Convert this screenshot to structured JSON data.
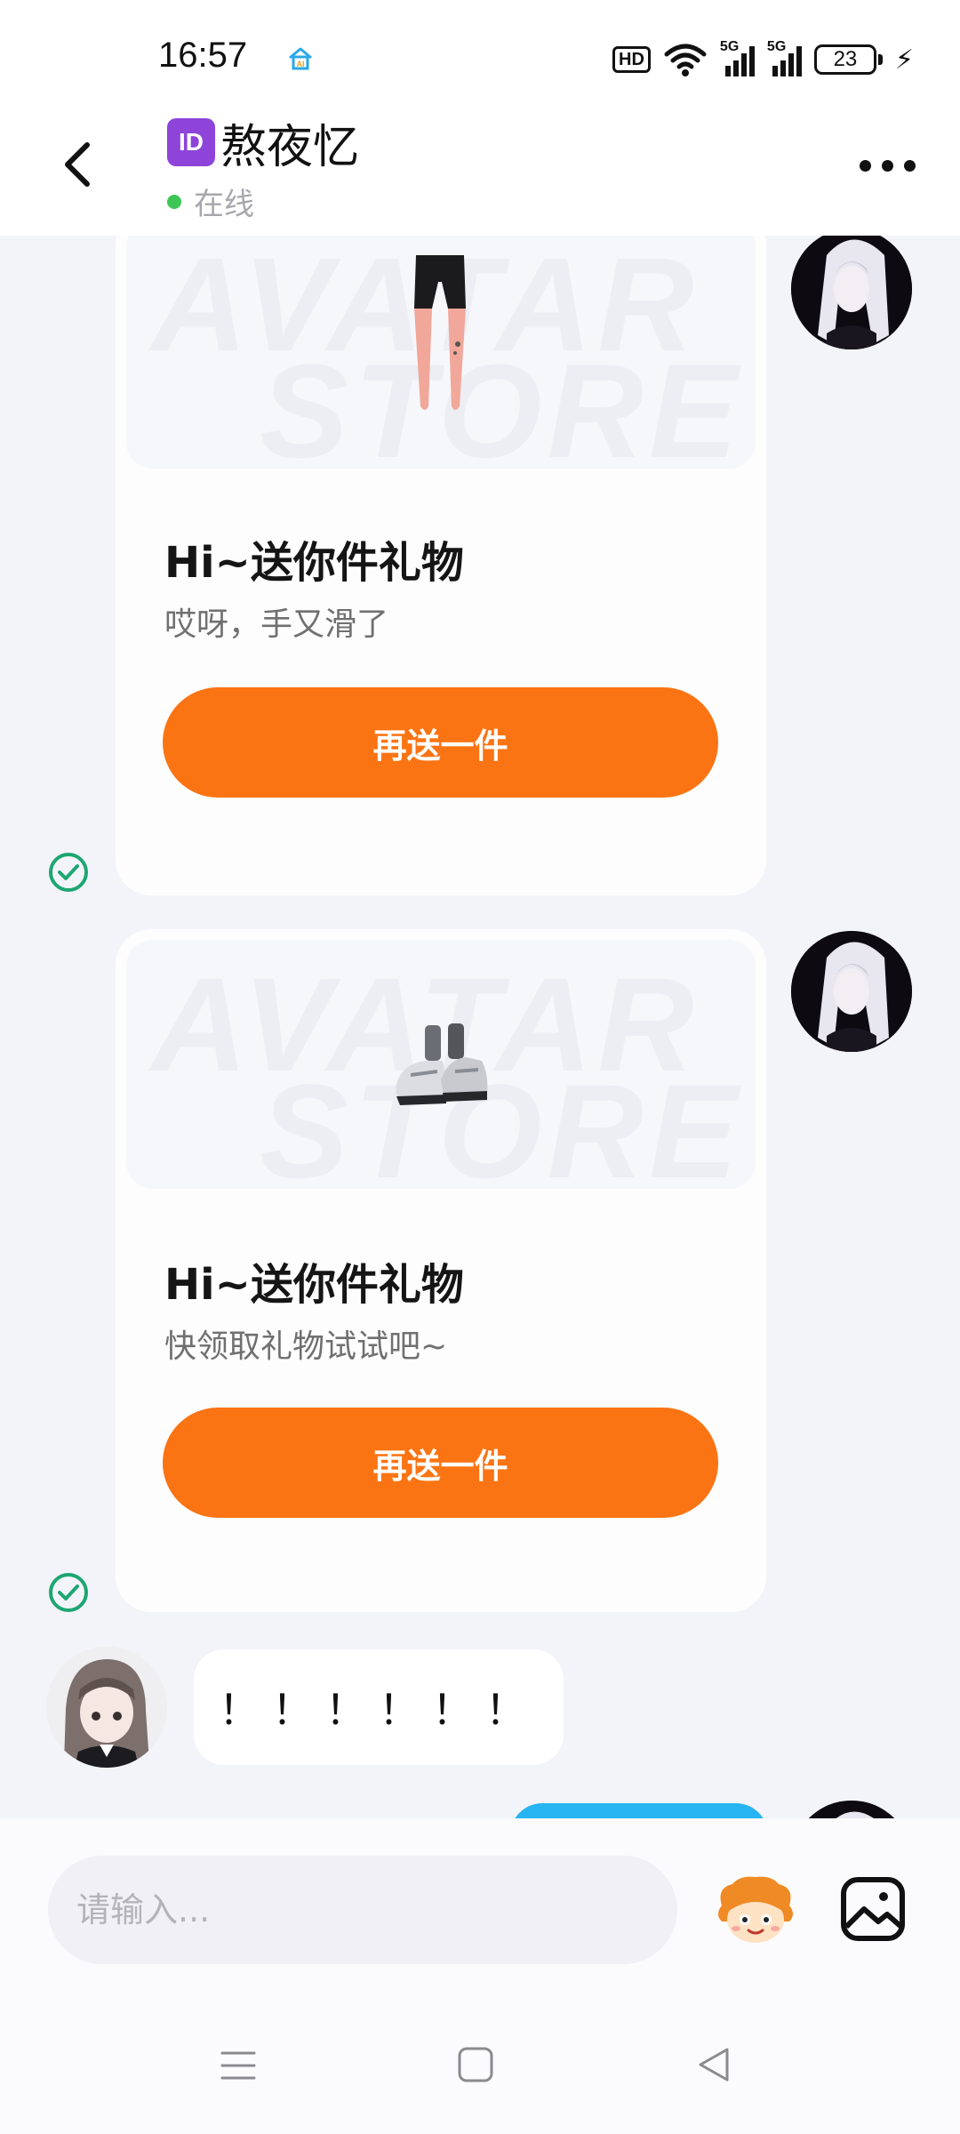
{
  "status_bar": {
    "time": "16:57",
    "network_badge": "HD",
    "signal1_label": "5G",
    "signal2_label": "5G",
    "battery": "23",
    "icons": [
      "ai-home-icon",
      "hd-icon",
      "wifi-icon",
      "signal-5g-icon",
      "signal-5g-icon",
      "battery-icon",
      "charging-bolt-icon"
    ]
  },
  "header": {
    "id_badge": "ID",
    "title": "熬夜忆",
    "status": "在线",
    "back_icon": "chevron-left-icon",
    "more_icon": "more-dots-icon"
  },
  "messages": [
    {
      "type": "gift",
      "sender": "me",
      "watermark_line1": "AVATAR",
      "watermark_line2": "STORE",
      "item": "leggings",
      "title": "Hi~送你件礼物",
      "subtitle": "哎呀，手又滑了",
      "button": "再送一件",
      "delivered": true
    },
    {
      "type": "gift",
      "sender": "me",
      "watermark_line1": "AVATAR",
      "watermark_line2": "STORE",
      "item": "sneakers",
      "title": "Hi~送你件礼物",
      "subtitle": "快领取礼物试试吧~",
      "button": "再送一件",
      "delivered": true
    },
    {
      "type": "text",
      "sender": "other",
      "text": "！！！！！！"
    }
  ],
  "input": {
    "placeholder": "请输入...",
    "value": ""
  },
  "nav": {
    "icons": [
      "menu-icon",
      "home-square-icon",
      "back-triangle-icon"
    ]
  },
  "colors": {
    "accent_orange": "#fb7413",
    "online_green": "#3cc654",
    "check_green": "#1ea672",
    "bubble_blue": "#27b4f2",
    "chat_bg": "#f3f4f9"
  }
}
